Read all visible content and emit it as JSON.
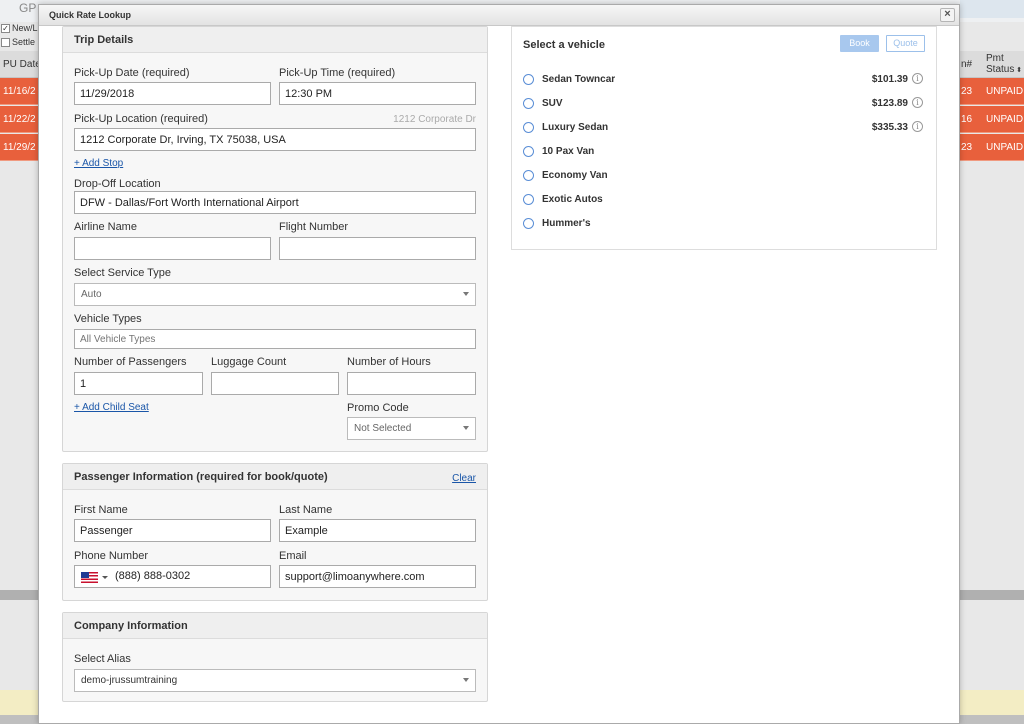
{
  "background": {
    "app_label": "GP",
    "checkboxes": [
      {
        "label": "New/L",
        "checked": true
      },
      {
        "label": "Settle",
        "checked": false
      }
    ],
    "table": {
      "headers": {
        "pu_date": "PU Date",
        "res_no": "n#",
        "pmt_status_line1": "Pmt",
        "pmt_status_line2": "Status"
      },
      "rows": [
        {
          "date": "11/16/2",
          "num": "23",
          "status": "UNPAID"
        },
        {
          "date": "11/22/2",
          "num": "16",
          "status": "UNPAID"
        },
        {
          "date": "11/29/2",
          "num": "23",
          "status": "UNPAID"
        }
      ]
    }
  },
  "modal": {
    "title": "Quick Rate Lookup",
    "close_glyph": "×"
  },
  "trip": {
    "header": "Trip Details",
    "pickup_date_label": "Pick-Up Date (required)",
    "pickup_date_value": "11/29/2018",
    "pickup_time_label": "Pick-Up Time (required)",
    "pickup_time_value": "12:30 PM",
    "pickup_location_label": "Pick-Up Location (required)",
    "pickup_location_hint": "1212 Corporate Dr",
    "pickup_location_value": "1212 Corporate Dr, Irving, TX 75038, USA",
    "add_stop": "+ Add Stop",
    "dropoff_label": "Drop-Off Location",
    "dropoff_value": "DFW - Dallas/Fort Worth International Airport",
    "airline_label": "Airline Name",
    "airline_value": "",
    "flight_label": "Flight Number",
    "flight_value": "",
    "service_type_label": "Select Service Type",
    "service_type_value": "Auto",
    "vehicle_types_label": "Vehicle Types",
    "vehicle_types_placeholder": "All Vehicle Types",
    "passengers_label": "Number of Passengers",
    "passengers_value": "1",
    "luggage_label": "Luggage Count",
    "luggage_value": "",
    "hours_label": "Number of Hours",
    "hours_value": "",
    "add_child_seat": "+ Add Child Seat",
    "promo_label": "Promo Code",
    "promo_value": "Not Selected"
  },
  "passenger": {
    "header": "Passenger Information (required for book/quote)",
    "clear": "Clear",
    "first_name_label": "First Name",
    "first_name_value": "Passenger",
    "last_name_label": "Last Name",
    "last_name_value": "Example",
    "phone_label": "Phone Number",
    "phone_value": "(888) 888-0302",
    "email_label": "Email",
    "email_value": "support@limoanywhere.com"
  },
  "company": {
    "header": "Company Information",
    "alias_label": "Select Alias",
    "alias_value": "demo-jrussumtraining"
  },
  "vehicles": {
    "title": "Select a vehicle",
    "book": "Book",
    "quote": "Quote",
    "info_glyph": "i",
    "items": [
      {
        "name": "Sedan Towncar",
        "price": "$101.39",
        "info": true
      },
      {
        "name": "SUV",
        "price": "$123.89",
        "info": true
      },
      {
        "name": "Luxury Sedan",
        "price": "$335.33",
        "info": true
      },
      {
        "name": "10 Pax Van",
        "price": "",
        "info": false
      },
      {
        "name": "Economy Van",
        "price": "",
        "info": false
      },
      {
        "name": "Exotic Autos",
        "price": "",
        "info": false
      },
      {
        "name": "Hummer's",
        "price": "",
        "info": false
      }
    ]
  },
  "colors": {
    "unpaid_row": "#e8603c",
    "link": "#1a56a8",
    "book_button": "#a8c8ee",
    "radio": "#5a8ed6"
  }
}
